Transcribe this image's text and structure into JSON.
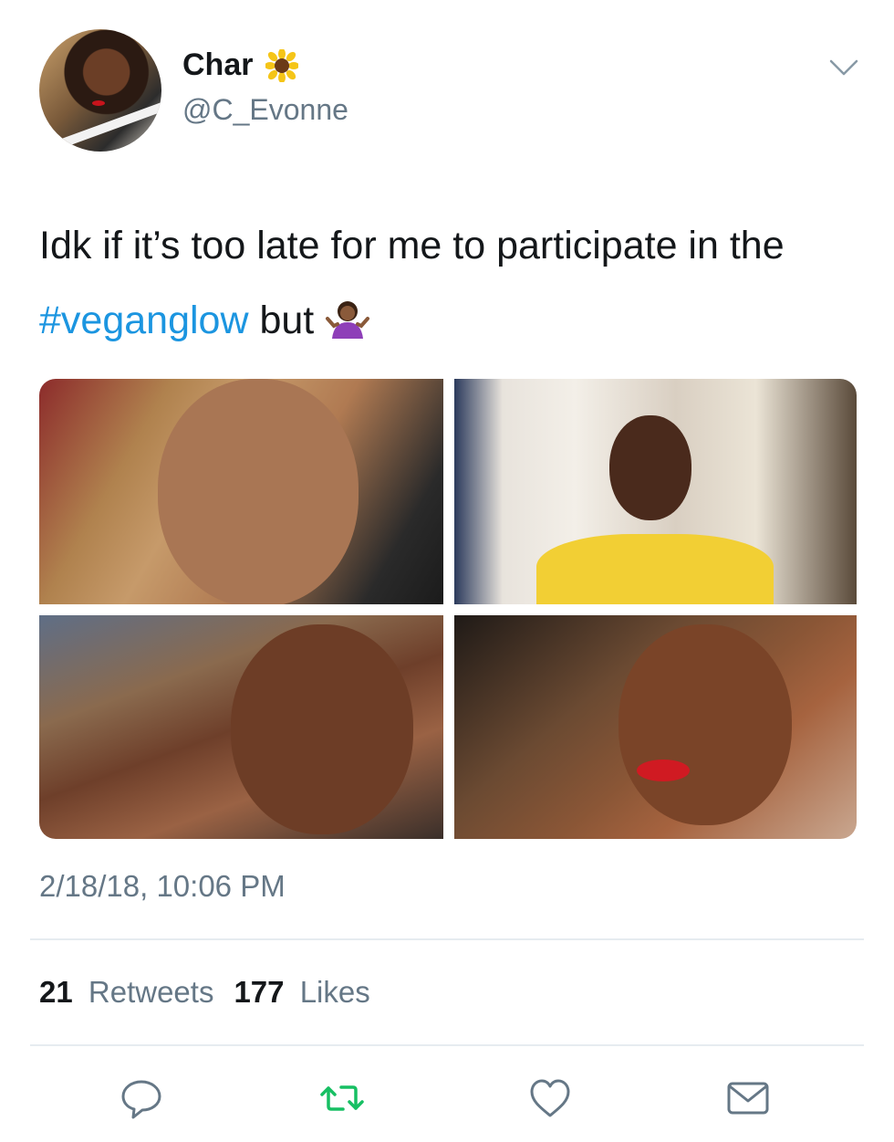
{
  "user": {
    "display_name": "Char",
    "handle": "@C_Evonne",
    "avatar_icon": "profile-avatar",
    "name_emoji_icon": "sunflower-icon"
  },
  "tweet": {
    "text_before": "Idk if it’s too late for me to participate in the ",
    "hashtag": "#veganglow",
    "text_after": " but",
    "trailing_emoji_icon": "woman-shrugging-icon",
    "timestamp": "2/18/18, 10:06 PM"
  },
  "stats": {
    "retweets_count": "21",
    "retweets_label": "Retweets",
    "likes_count": "177",
    "likes_label": "Likes"
  },
  "actions": {
    "reply_icon": "reply-icon",
    "retweet_icon": "retweet-icon",
    "like_icon": "heart-icon",
    "dm_icon": "envelope-icon"
  },
  "colors": {
    "hashtag": "#1b95e0",
    "secondary_text": "#657786",
    "retweet_green": "#17bf63",
    "icon_gray": "#657786"
  }
}
